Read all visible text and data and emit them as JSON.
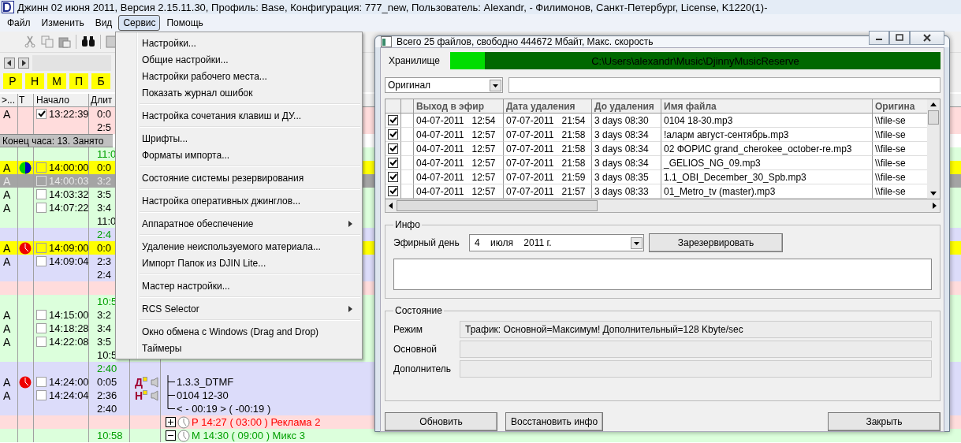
{
  "window": {
    "title": "Джинн 02 июня 2011, Версия 2.15.11.30, Профиль: Base, Конфигурация: 777_new, Пользователь: Alexandr, - Филимонов, Санкт-Петербург,  License, K1220(1)-"
  },
  "menubar": [
    {
      "label": "Файл",
      "selected": false
    },
    {
      "label": "Изменить",
      "selected": false
    },
    {
      "label": "Вид",
      "selected": false
    },
    {
      "label": "Сервис",
      "selected": true
    },
    {
      "label": "Помощь",
      "selected": false
    }
  ],
  "day_buttons": [
    "Р",
    "Н",
    "М",
    "П",
    "Б"
  ],
  "grid": {
    "columns": [
      ">...",
      "Т",
      "Начало",
      "Длит"
    ],
    "blocks": [
      {
        "kind": "rows",
        "color": "#ffdcdc",
        "rows": [
          {
            "kind": "item",
            "code": "A",
            "checked": true,
            "selected": false,
            "start": "13:22:39",
            "duration": "0:0"
          },
          {
            "kind": "total",
            "value": "2:5"
          }
        ]
      },
      {
        "kind": "band",
        "text": "Конец часа: 13. Занято"
      },
      {
        "kind": "rows",
        "color": "#dcffdc",
        "rows": [
          {
            "kind": "head",
            "value": "11:0"
          },
          {
            "kind": "item",
            "code": "A",
            "color": "#ffff00",
            "timer": {
              "kind": "pie"
            },
            "checked": false,
            "selected": false,
            "start": "14:00:00",
            "duration": "0:0"
          },
          {
            "kind": "item",
            "code": "A",
            "checked": false,
            "selected": true,
            "start": "14:00:03",
            "duration": "3:2"
          },
          {
            "kind": "item",
            "code": "A",
            "checked": false,
            "selected": false,
            "start": "14:03:32",
            "duration": "3:5"
          },
          {
            "kind": "item",
            "code": "A",
            "checked": false,
            "selected": false,
            "start": "14:07:22",
            "duration": "3:4"
          },
          {
            "kind": "total",
            "value": "11:0"
          }
        ]
      },
      {
        "kind": "rows",
        "color": "#dcdcfa",
        "rows": [
          {
            "kind": "head",
            "value": "2:4"
          },
          {
            "kind": "item",
            "code": "A",
            "color": "#ffff00",
            "timer": {
              "kind": "clock"
            },
            "checked": false,
            "selected": false,
            "start": "14:09:00",
            "duration": "0:0"
          },
          {
            "kind": "item",
            "code": "A",
            "checked": false,
            "selected": false,
            "start": "14:09:04",
            "duration": "2:3"
          },
          {
            "kind": "total",
            "value": "2:4"
          }
        ]
      },
      {
        "kind": "rows",
        "color": "#ffdcdc",
        "rows": [
          {
            "kind": "blank"
          }
        ]
      },
      {
        "kind": "rows",
        "color": "#dcffdc",
        "rows": [
          {
            "kind": "head",
            "value": "10:5"
          },
          {
            "kind": "item",
            "code": "A",
            "checked": false,
            "selected": false,
            "start": "14:15:00",
            "duration": "3:2"
          },
          {
            "kind": "item",
            "code": "A",
            "checked": false,
            "selected": false,
            "start": "14:18:28",
            "duration": "3:4"
          },
          {
            "kind": "item",
            "code": "A",
            "checked": false,
            "selected": false,
            "start": "14:22:08",
            "duration": "3:5"
          },
          {
            "kind": "total",
            "value": "10:5"
          }
        ]
      },
      {
        "kind": "rows",
        "color": "#dcdcfa",
        "rows": [
          {
            "kind": "head",
            "value": "2:40"
          },
          {
            "kind": "item",
            "code": "A",
            "timer": {
              "kind": "clock"
            },
            "checked": false,
            "selected": false,
            "start": "14:24:00",
            "duration": "0:05",
            "tag": "Д",
            "tree": {
              "kind": "leaf",
              "last": false,
              "text": "1.3.3_DTMF"
            }
          },
          {
            "kind": "item",
            "code": "A",
            "checked": false,
            "selected": false,
            "start": "14:24:04",
            "duration": "2:36",
            "tag": "Н",
            "tree": {
              "kind": "leaf",
              "last": false,
              "text": "0104 12-30"
            }
          },
          {
            "kind": "total",
            "value": "2:40",
            "tree": {
              "kind": "leaf",
              "last": true,
              "text": "< - 00:19 > ( -00:19 )"
            }
          }
        ]
      },
      {
        "kind": "rows",
        "color": "#ffdcdc",
        "rows": [
          {
            "kind": "blank",
            "tree": {
              "kind": "node",
              "expanded": false,
              "color": "#ff0000",
              "text": "Р 14:27 ( 03:00 ) Реклама 2"
            }
          }
        ]
      },
      {
        "kind": "rows",
        "color": "#dcffdc",
        "rows": [
          {
            "kind": "head",
            "value": "10:58",
            "tree": {
              "kind": "node",
              "expanded": true,
              "color": "#00a000",
              "text": "М 14:30 ( 09:00 ) Микс 3"
            }
          }
        ]
      }
    ]
  },
  "menu": {
    "items": [
      {
        "kind": "item",
        "label": "Настройки..."
      },
      {
        "kind": "item",
        "label": "Общие настройки..."
      },
      {
        "kind": "item",
        "label": "Настройки рабочего места..."
      },
      {
        "kind": "item",
        "label": "Показать журнал ошибок"
      },
      {
        "kind": "separator"
      },
      {
        "kind": "item",
        "label": "Настройка сочетания клавиш и ДУ..."
      },
      {
        "kind": "separator"
      },
      {
        "kind": "item",
        "label": "Шрифты..."
      },
      {
        "kind": "item",
        "label": "Форматы импорта..."
      },
      {
        "kind": "separator"
      },
      {
        "kind": "item",
        "label": "Состояние системы резервирования"
      },
      {
        "kind": "separator"
      },
      {
        "kind": "item",
        "label": "Настройка оперативных джинглов..."
      },
      {
        "kind": "separator"
      },
      {
        "kind": "submenu",
        "label": "Аппаратное обеспечение"
      },
      {
        "kind": "separator"
      },
      {
        "kind": "item",
        "label": "Удаление неиспользуемого материала..."
      },
      {
        "kind": "item",
        "label": "Импорт Папок из DJIN Lite..."
      },
      {
        "kind": "separator"
      },
      {
        "kind": "item",
        "label": "Мастер настройки..."
      },
      {
        "kind": "separator"
      },
      {
        "kind": "submenu",
        "label": "RCS Selector"
      },
      {
        "kind": "separator"
      },
      {
        "kind": "item",
        "label": "Окно обмена с Windows (Drag and Drop)"
      },
      {
        "kind": "item",
        "label": "Таймеры"
      }
    ]
  },
  "dialog": {
    "title": "Всего 25 файлов, свободно 444672 Мбайт, Макс. скорость",
    "storage": {
      "label": "Хранилище",
      "path": "C:\\Users\\alexandr\\Music\\DjinnyMusicReserve",
      "level": 0.07
    },
    "filter": {
      "value": "Оригинал"
    },
    "table": {
      "columns": [
        "Выход в эфир",
        "Дата удаления",
        "До удаления",
        "Имя файла",
        "Оригина"
      ],
      "rows": [
        {
          "checked": true,
          "cells": [
            "04-07-2011   12:54",
            "07-07-2011   21:54",
            "3 days 08:30",
            "0104 18-30.mp3",
            "\\\\file-se"
          ]
        },
        {
          "checked": true,
          "cells": [
            "04-07-2011   12:57",
            "07-07-2011   21:58",
            "3 days 08:34",
            "!аларм август-сентябрь.mp3",
            "\\\\file-se"
          ]
        },
        {
          "checked": true,
          "cells": [
            "04-07-2011   12:57",
            "07-07-2011   21:58",
            "3 days 08:34",
            "02 ФОРИС grand_cherokee_october-re.mp3",
            "\\\\file-se"
          ]
        },
        {
          "checked": true,
          "cells": [
            "04-07-2011   12:57",
            "07-07-2011   21:58",
            "3 days 08:34",
            "_GELIOS_NG_09.mp3",
            "\\\\file-se"
          ]
        },
        {
          "checked": true,
          "cells": [
            "04-07-2011   12:57",
            "07-07-2011   21:59",
            "3 days 08:35",
            "1.1_OBI_December_30_Spb.mp3",
            "\\\\file-se"
          ]
        },
        {
          "checked": true,
          "cells": [
            "04-07-2011   12:57",
            "07-07-2011   21:57",
            "3 days 08:33",
            "01_Metro_tv (master).mp3",
            "\\\\file-se"
          ]
        }
      ]
    },
    "info": {
      "title": "Инфо",
      "day_label": "Эфирный день",
      "day_value": "4    июля    2011 г.",
      "reserve_button": "Зарезервировать"
    },
    "status": {
      "title": "Состояние",
      "fields": [
        {
          "label": "Режим",
          "value": "Трафик: Основной=Максимум! Дополнительный=128 Kbyte/sec"
        },
        {
          "label": "Основной"
        },
        {
          "label": "Дополнитель"
        }
      ]
    },
    "buttons": [
      "Обновить",
      "Восстановить инфо",
      "Закрыть"
    ]
  }
}
